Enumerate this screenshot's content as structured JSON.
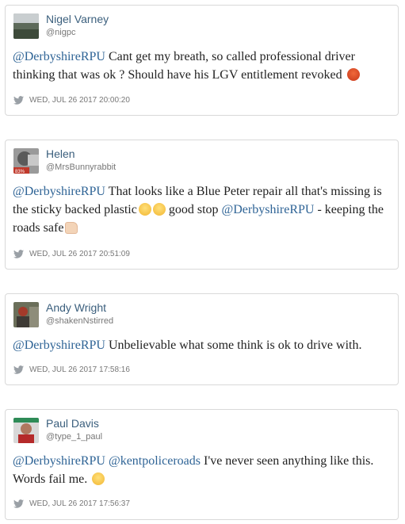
{
  "tweets": [
    {
      "name": "Nigel Varney",
      "handle": "@nigpc",
      "mention1": "@DerbyshireRPU",
      "text1": " Cant get my breath, so called professional driver thinking that was ok ? Should have his LGV entitlement revoked ",
      "emoji1": "angry-face",
      "timestamp": "WED, JUL 26 2017 20:00:20"
    },
    {
      "name": "Helen",
      "handle": "@MrsBunnyrabbit",
      "mention1": "@DerbyshireRPU",
      "text1": " That looks like a Blue Peter repair all that's missing is the sticky backed plastic",
      "emoji1": "tears-of-joy",
      "emoji2": "tears-of-joy",
      "text2": " good stop ",
      "mention2": "@DerbyshireRPU",
      "text3": " - keeping the roads safe",
      "emoji3": "thumbs-up",
      "timestamp": "WED, JUL 26 2017 20:51:09"
    },
    {
      "name": "Andy Wright",
      "handle": "@shakenNstirred",
      "mention1": "@DerbyshireRPU",
      "text1": " Unbelievable what some think is ok to drive with.",
      "timestamp": "WED, JUL 26 2017 17:58:16"
    },
    {
      "name": "Paul Davis",
      "handle": "@type_1_paul",
      "mention1": "@DerbyshireRPU",
      "text1": " ",
      "mention2": "@kentpoliceroads",
      "text2": " I've never seen anything like this. Words fail me. ",
      "emoji1": "confused-face",
      "timestamp": "WED, JUL 26 2017 17:56:37"
    }
  ],
  "colors": {
    "name": "#3b5f7d",
    "mention": "#2f6496",
    "meta": "#777777",
    "border": "#d9d9d9"
  }
}
